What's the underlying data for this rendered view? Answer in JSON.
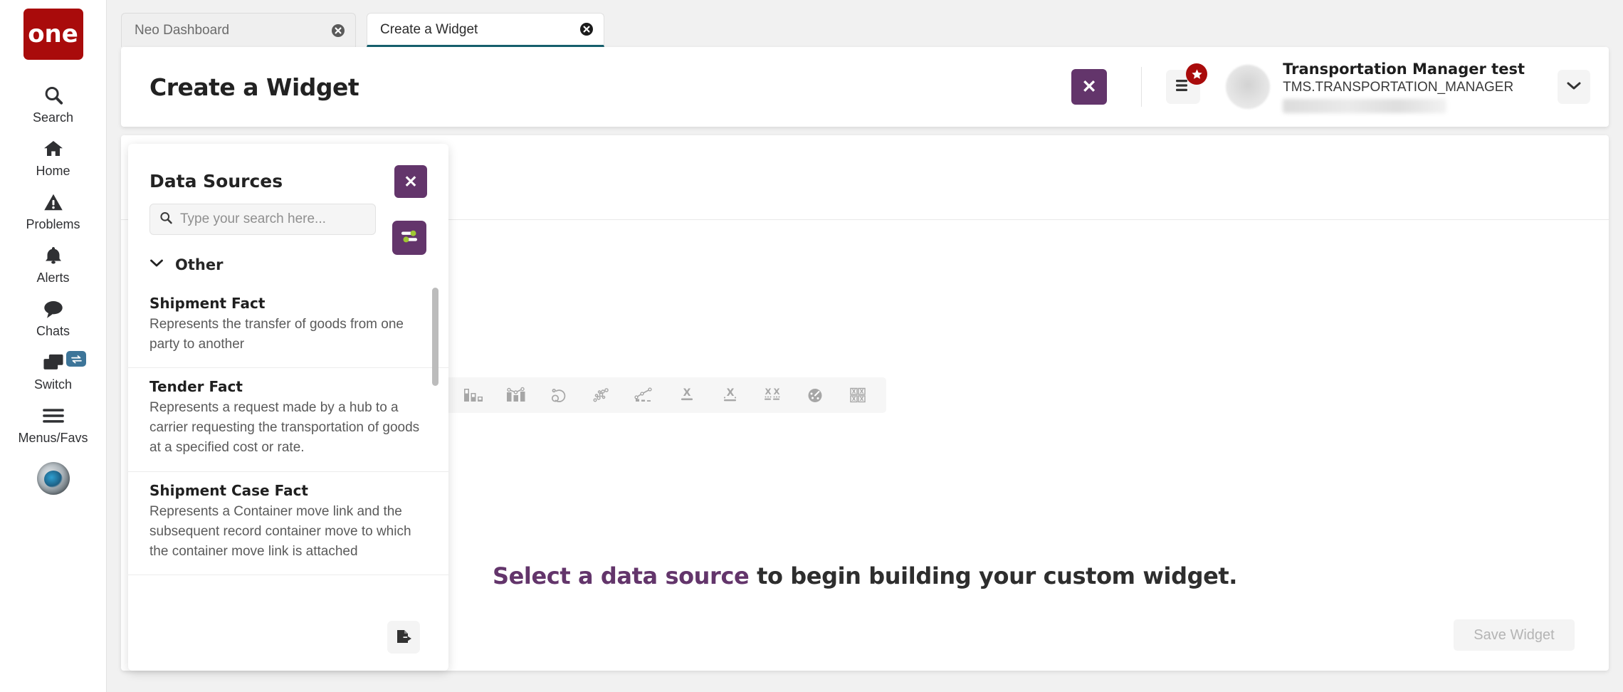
{
  "brand": {
    "logo_text": "one",
    "logo_color": "#a90b0b"
  },
  "accent": {
    "purple": "#63356b",
    "tab_underline": "#17606e",
    "green": "#9fc733"
  },
  "rail": {
    "items": [
      {
        "label": "Search",
        "icon": "search-icon"
      },
      {
        "label": "Home",
        "icon": "home-icon"
      },
      {
        "label": "Problems",
        "icon": "warning-triangle-icon"
      },
      {
        "label": "Alerts",
        "icon": "bell-icon"
      },
      {
        "label": "Chats",
        "icon": "chat-bubble-icon"
      },
      {
        "label": "Switch",
        "icon": "windows-stack-icon",
        "badge_icon": "swap-arrows-icon"
      },
      {
        "label": "Menus/Favs",
        "icon": "hamburger-icon"
      }
    ]
  },
  "tabs": [
    {
      "label": "Neo Dashboard",
      "active": false,
      "close_icon": "close-circle-icon"
    },
    {
      "label": "Create a Widget",
      "active": true,
      "close_icon": "close-circle-icon"
    }
  ],
  "header": {
    "title": "Create a Widget",
    "close_label": "✕",
    "menu_icon": "list-menu-icon",
    "badge_icon": "star-icon",
    "user_name": "Transportation Manager test",
    "user_role": "TMS.TRANSPORTATION_MANAGER",
    "chevron_icon": "chevron-down-icon"
  },
  "data_sources": {
    "title": "Data Sources",
    "close_label": "✕",
    "search_placeholder": "Type your search here...",
    "search_value": "",
    "search_icon": "search-icon",
    "filter_icon": "filter-sliders-icon",
    "group": {
      "label": "Other",
      "expanded": true,
      "chevron_icon": "chevron-down-icon"
    },
    "items": [
      {
        "name": "Shipment Fact",
        "description": "Represents the transfer of goods from one party to another"
      },
      {
        "name": "Tender Fact",
        "description": "Represents a request made by a hub to a carrier requesting the transportation of goods at a specified cost or rate."
      },
      {
        "name": "Shipment Case Fact",
        "description": "Represents a Container move link and the subsequent record container move to which the container move link is attached"
      }
    ],
    "export_icon": "file-export-icon"
  },
  "widget_toolbar": {
    "tools": [
      {
        "icon": "horizontal-bar-chart-icon",
        "name": "horizontal-bar-chart"
      },
      {
        "icon": "combo-bar-line-chart-icon",
        "name": "combo-chart"
      },
      {
        "icon": "donut-chart-icon",
        "name": "donut-chart"
      },
      {
        "icon": "bubble-chart-icon",
        "name": "bubble-chart"
      },
      {
        "icon": "line-bar-chart-icon",
        "name": "line-bar-chart"
      },
      {
        "icon": "single-metric-icon",
        "name": "single-metric"
      },
      {
        "icon": "metric-with-trend-icon",
        "name": "metric-with-trend"
      },
      {
        "icon": "dual-metric-icon",
        "name": "dual-metric"
      },
      {
        "icon": "gauge-chart-icon",
        "name": "gauge-chart"
      },
      {
        "icon": "grid-tiles-icon",
        "name": "grid-tiles"
      }
    ]
  },
  "main": {
    "message_highlight": "Select a data source",
    "message_rest": " to begin building your custom widget.",
    "save_label": "Save Widget"
  }
}
